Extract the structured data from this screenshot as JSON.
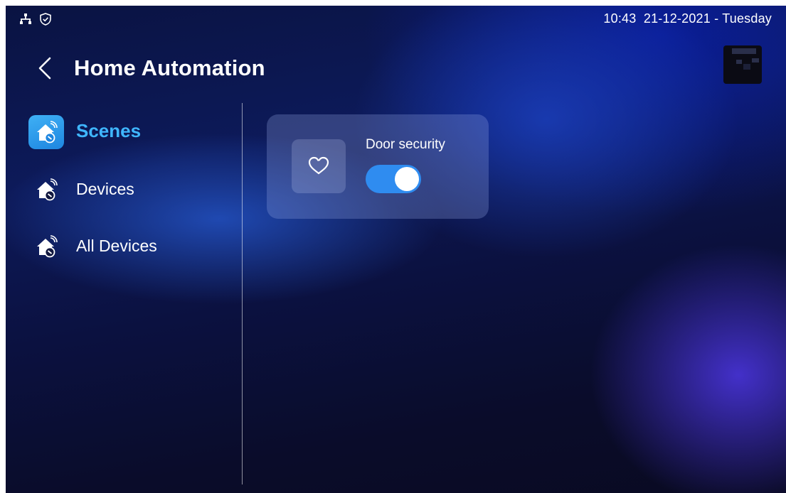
{
  "status_bar": {
    "icons": [
      "network-icon",
      "shield-check-icon"
    ],
    "time": "10:43",
    "date": "21-12-2021 - Tuesday"
  },
  "header": {
    "back_icon": "chevron-left-icon",
    "title": "Home Automation"
  },
  "sidebar": {
    "items": [
      {
        "label": "Scenes",
        "icon": "smart-home-icon",
        "active": true
      },
      {
        "label": "Devices",
        "icon": "smart-home-icon",
        "active": false
      },
      {
        "label": "All Devices",
        "icon": "smart-home-icon",
        "active": false
      }
    ]
  },
  "scenes": [
    {
      "name": "Door security",
      "icon": "heart-icon",
      "enabled": true
    }
  ],
  "colors": {
    "accent": "#3fb6ff",
    "toggle_on": "#2f8cf0",
    "background": "#0b1140"
  }
}
